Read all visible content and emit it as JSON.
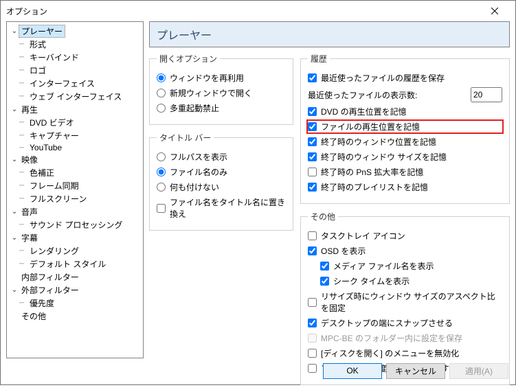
{
  "window": {
    "title": "オプション"
  },
  "tree": {
    "nodes": [
      {
        "label": "プレーヤー",
        "children": [
          "形式",
          "キーバインド",
          "ロゴ",
          "インターフェイス",
          "ウェブ インターフェイス"
        ]
      },
      {
        "label": "再生",
        "children": [
          "DVD ビデオ",
          "キャプチャー",
          "YouTube"
        ]
      },
      {
        "label": "映像",
        "children": [
          "色補正",
          "フレーム同期",
          "フルスクリーン"
        ]
      },
      {
        "label": "音声",
        "children": [
          "サウンド プロセッシング"
        ]
      },
      {
        "label": "字幕",
        "children": [
          "レンダリング",
          "デフォルト スタイル"
        ]
      },
      {
        "label": "内部フィルター",
        "children": []
      },
      {
        "label": "外部フィルター",
        "children": [
          "優先度"
        ]
      },
      {
        "label": "その他",
        "children": []
      }
    ]
  },
  "panel": {
    "header": "プレーヤー"
  },
  "open_options": {
    "legend": "開くオプション",
    "reuse": "ウィンドウを再利用",
    "new_window": "新規ウィンドウで開く",
    "single_instance": "多重起動禁止"
  },
  "titlebar_opts": {
    "legend": "タイトル バー",
    "fullpath": "フルパスを表示",
    "filename": "ファイル名のみ",
    "nothing": "何も付けない",
    "replace": "ファイル名をタイトル名に置き換え"
  },
  "history": {
    "legend": "履歴",
    "save_history": "最近使ったファイルの履歴を保存",
    "display_count_label": "最近使ったファイルの表示数:",
    "display_count_value": 20,
    "remember_dvd": "DVD の再生位置を記憶",
    "remember_file_pos": "ファイルの再生位置を記憶",
    "remember_window_pos": "終了時のウィンドウ位置を記憶",
    "remember_window_size": "終了時のウィンドウ サイズを記憶",
    "remember_pns": "終了時の PnS 拡大率を記憶",
    "remember_playlist": "終了時のプレイリストを記憶"
  },
  "other": {
    "legend": "その他",
    "tray_icon": "タスクトレイ アイコン",
    "osd": "OSD を表示",
    "media_filename": "メディア ファイル名を表示",
    "seek_time": "シーク タイムを表示",
    "keep_aspect": "リサイズ時にウィンドウ サイズのアスペクト比を固定",
    "snap_desktop": "デスクトップの端にスナップさせる",
    "save_settings_folder": "MPC-BE のフォルダー内に設定を保存",
    "disable_open_disc": "[ディスクを開く] のメニューを無効化",
    "priority_above_normal": "プロセスの優先度を 通常以上 にする"
  },
  "buttons": {
    "ok": "OK",
    "cancel": "キャンセル",
    "apply": "適用(A)"
  }
}
